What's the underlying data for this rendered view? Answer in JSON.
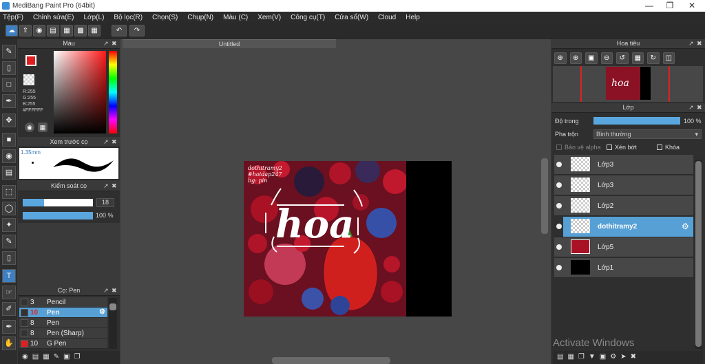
{
  "window": {
    "title": "MediBang Paint Pro (64bit)"
  },
  "menu": [
    "Tệp(F)",
    "Chỉnh sửa(E)",
    "Lớp(L)",
    "Bộ lọc(R)",
    "Chọn(S)",
    "Chụp(N)",
    "Màu (C)",
    "Xem(V)",
    "Công cụ(T)",
    "Cửa sổ(W)",
    "Cloud",
    "Help"
  ],
  "color_panel": {
    "title": "Màu",
    "r": "R:255",
    "g": "G:255",
    "b": "B:255",
    "hex": "#FFFFFF"
  },
  "preview_panel": {
    "title": "Xem trước cọ",
    "size": "1.35mm"
  },
  "brush_control": {
    "title": "Kiểm soát cọ",
    "size_value": "18",
    "opacity_value": "100 %",
    "size_fill": 0.3,
    "opacity_fill": 1.0
  },
  "brush_panel": {
    "title": "Cọ: Pen",
    "items": [
      {
        "size": "3",
        "name": "Pencil",
        "color": "#333333",
        "selected": false
      },
      {
        "size": "10",
        "name": "Pen",
        "color": "#333333",
        "selected": true
      },
      {
        "size": "8",
        "name": "Pen",
        "color": "#333333",
        "selected": false
      },
      {
        "size": "8",
        "name": "Pen (Sharp)",
        "color": "#333333",
        "selected": false
      },
      {
        "size": "10",
        "name": "G Pen",
        "color": "#e02020",
        "selected": false
      }
    ]
  },
  "document": {
    "tab": "Untitled",
    "canvas_text": {
      "line1": "dothitramy2",
      "line2": "#hoidap247",
      "line3": "bg: pin",
      "word": "hoa"
    }
  },
  "navigator": {
    "title": "Hoa tiêu"
  },
  "layers_panel": {
    "title": "Lớp",
    "opacity_label": "Độ trong",
    "opacity_value": "100 %",
    "opacity_fill": 1.0,
    "blend_label": "Pha trộn",
    "blend_value": "Bình thường",
    "protect_alpha": "Bảo vệ alpha",
    "clipping": "Xén bớt",
    "lock": "Khóa",
    "layers": [
      {
        "name": "Lớp3",
        "thumb": "checker",
        "selected": false
      },
      {
        "name": "Lớp3",
        "thumb": "checker",
        "selected": false
      },
      {
        "name": "Lớp2",
        "thumb": "checker",
        "selected": false
      },
      {
        "name": "dothitramy2",
        "thumb": "checker",
        "selected": true
      },
      {
        "name": "Lớp5",
        "thumb": "photo",
        "selected": false
      },
      {
        "name": "Lớp1",
        "thumb": "black",
        "selected": false
      }
    ]
  },
  "watermark": "Activate Windows",
  "colors": {
    "accent": "#4a9ed8",
    "selected_layer": "#56a0d6",
    "red": "#e02020"
  }
}
